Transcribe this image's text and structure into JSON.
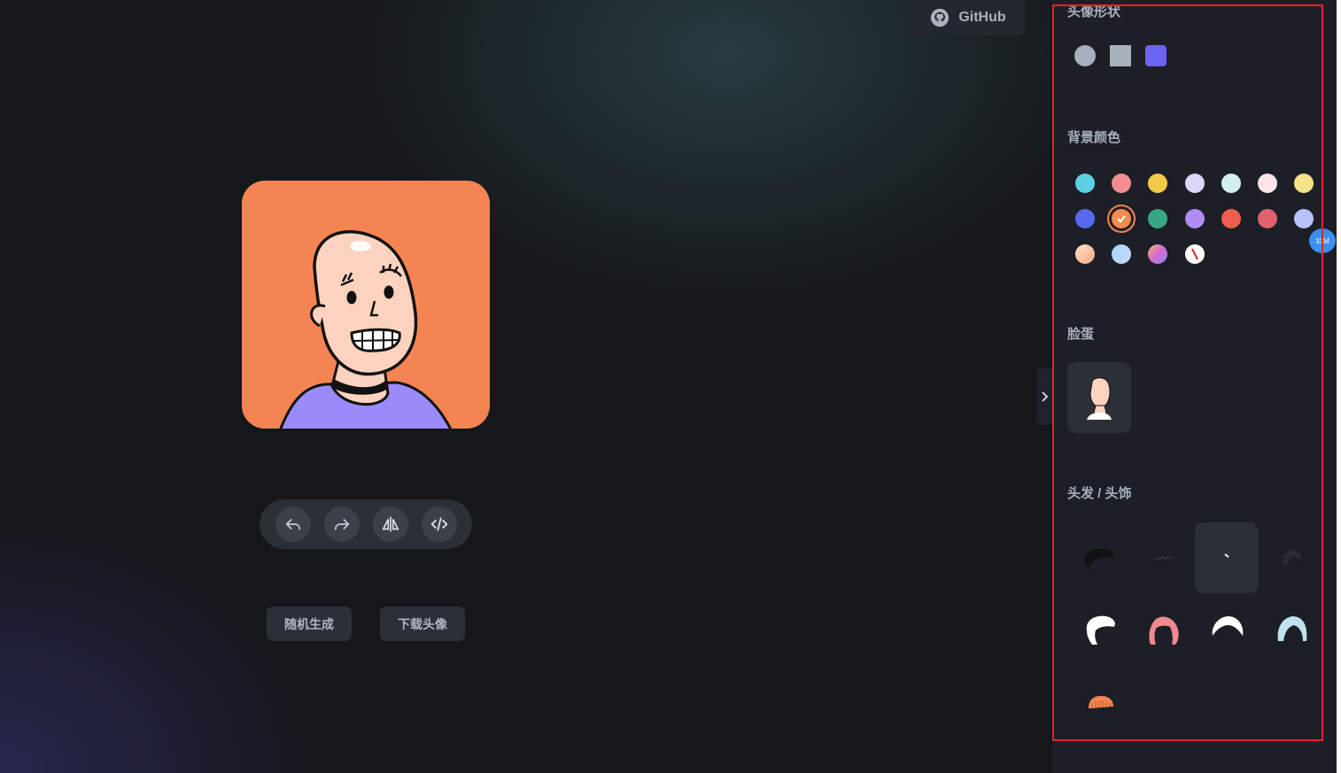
{
  "header": {
    "github_label": "GitHub"
  },
  "toolbar": {
    "tools": [
      {
        "name": "undo-icon"
      },
      {
        "name": "redo-icon"
      },
      {
        "name": "flip-icon"
      },
      {
        "name": "code-icon"
      }
    ]
  },
  "actions": {
    "random_label": "随机生成",
    "download_label": "下载头像"
  },
  "panel": {
    "shape_title": "头像形状",
    "shapes": [
      "circle",
      "square",
      "squircle"
    ],
    "bg_title": "背景颜色",
    "bg_colors": [
      "#5dd0e5",
      "#f38c94",
      "#f3c94a",
      "#ddd6f8",
      "#d4eff0",
      "#fbe5e8",
      "#f7e08a",
      "#5768f0",
      "#f48b4e",
      "#3aa688",
      "#b08cf4",
      "#f15e4f",
      "#e0616e",
      "#b9c2f8",
      "gradient-peach",
      "gradient-blue",
      "gradient-pink",
      "none-slash"
    ],
    "selected_color_index": 8,
    "face_title": "脸蛋",
    "hair_title": "头发 / 头饰",
    "badge": "33M"
  },
  "colors": {
    "avatar_bg": "#f48553",
    "skin": "#fdd3c0",
    "shirt": "#9b8bfa",
    "accent_border": "#e3242b"
  }
}
